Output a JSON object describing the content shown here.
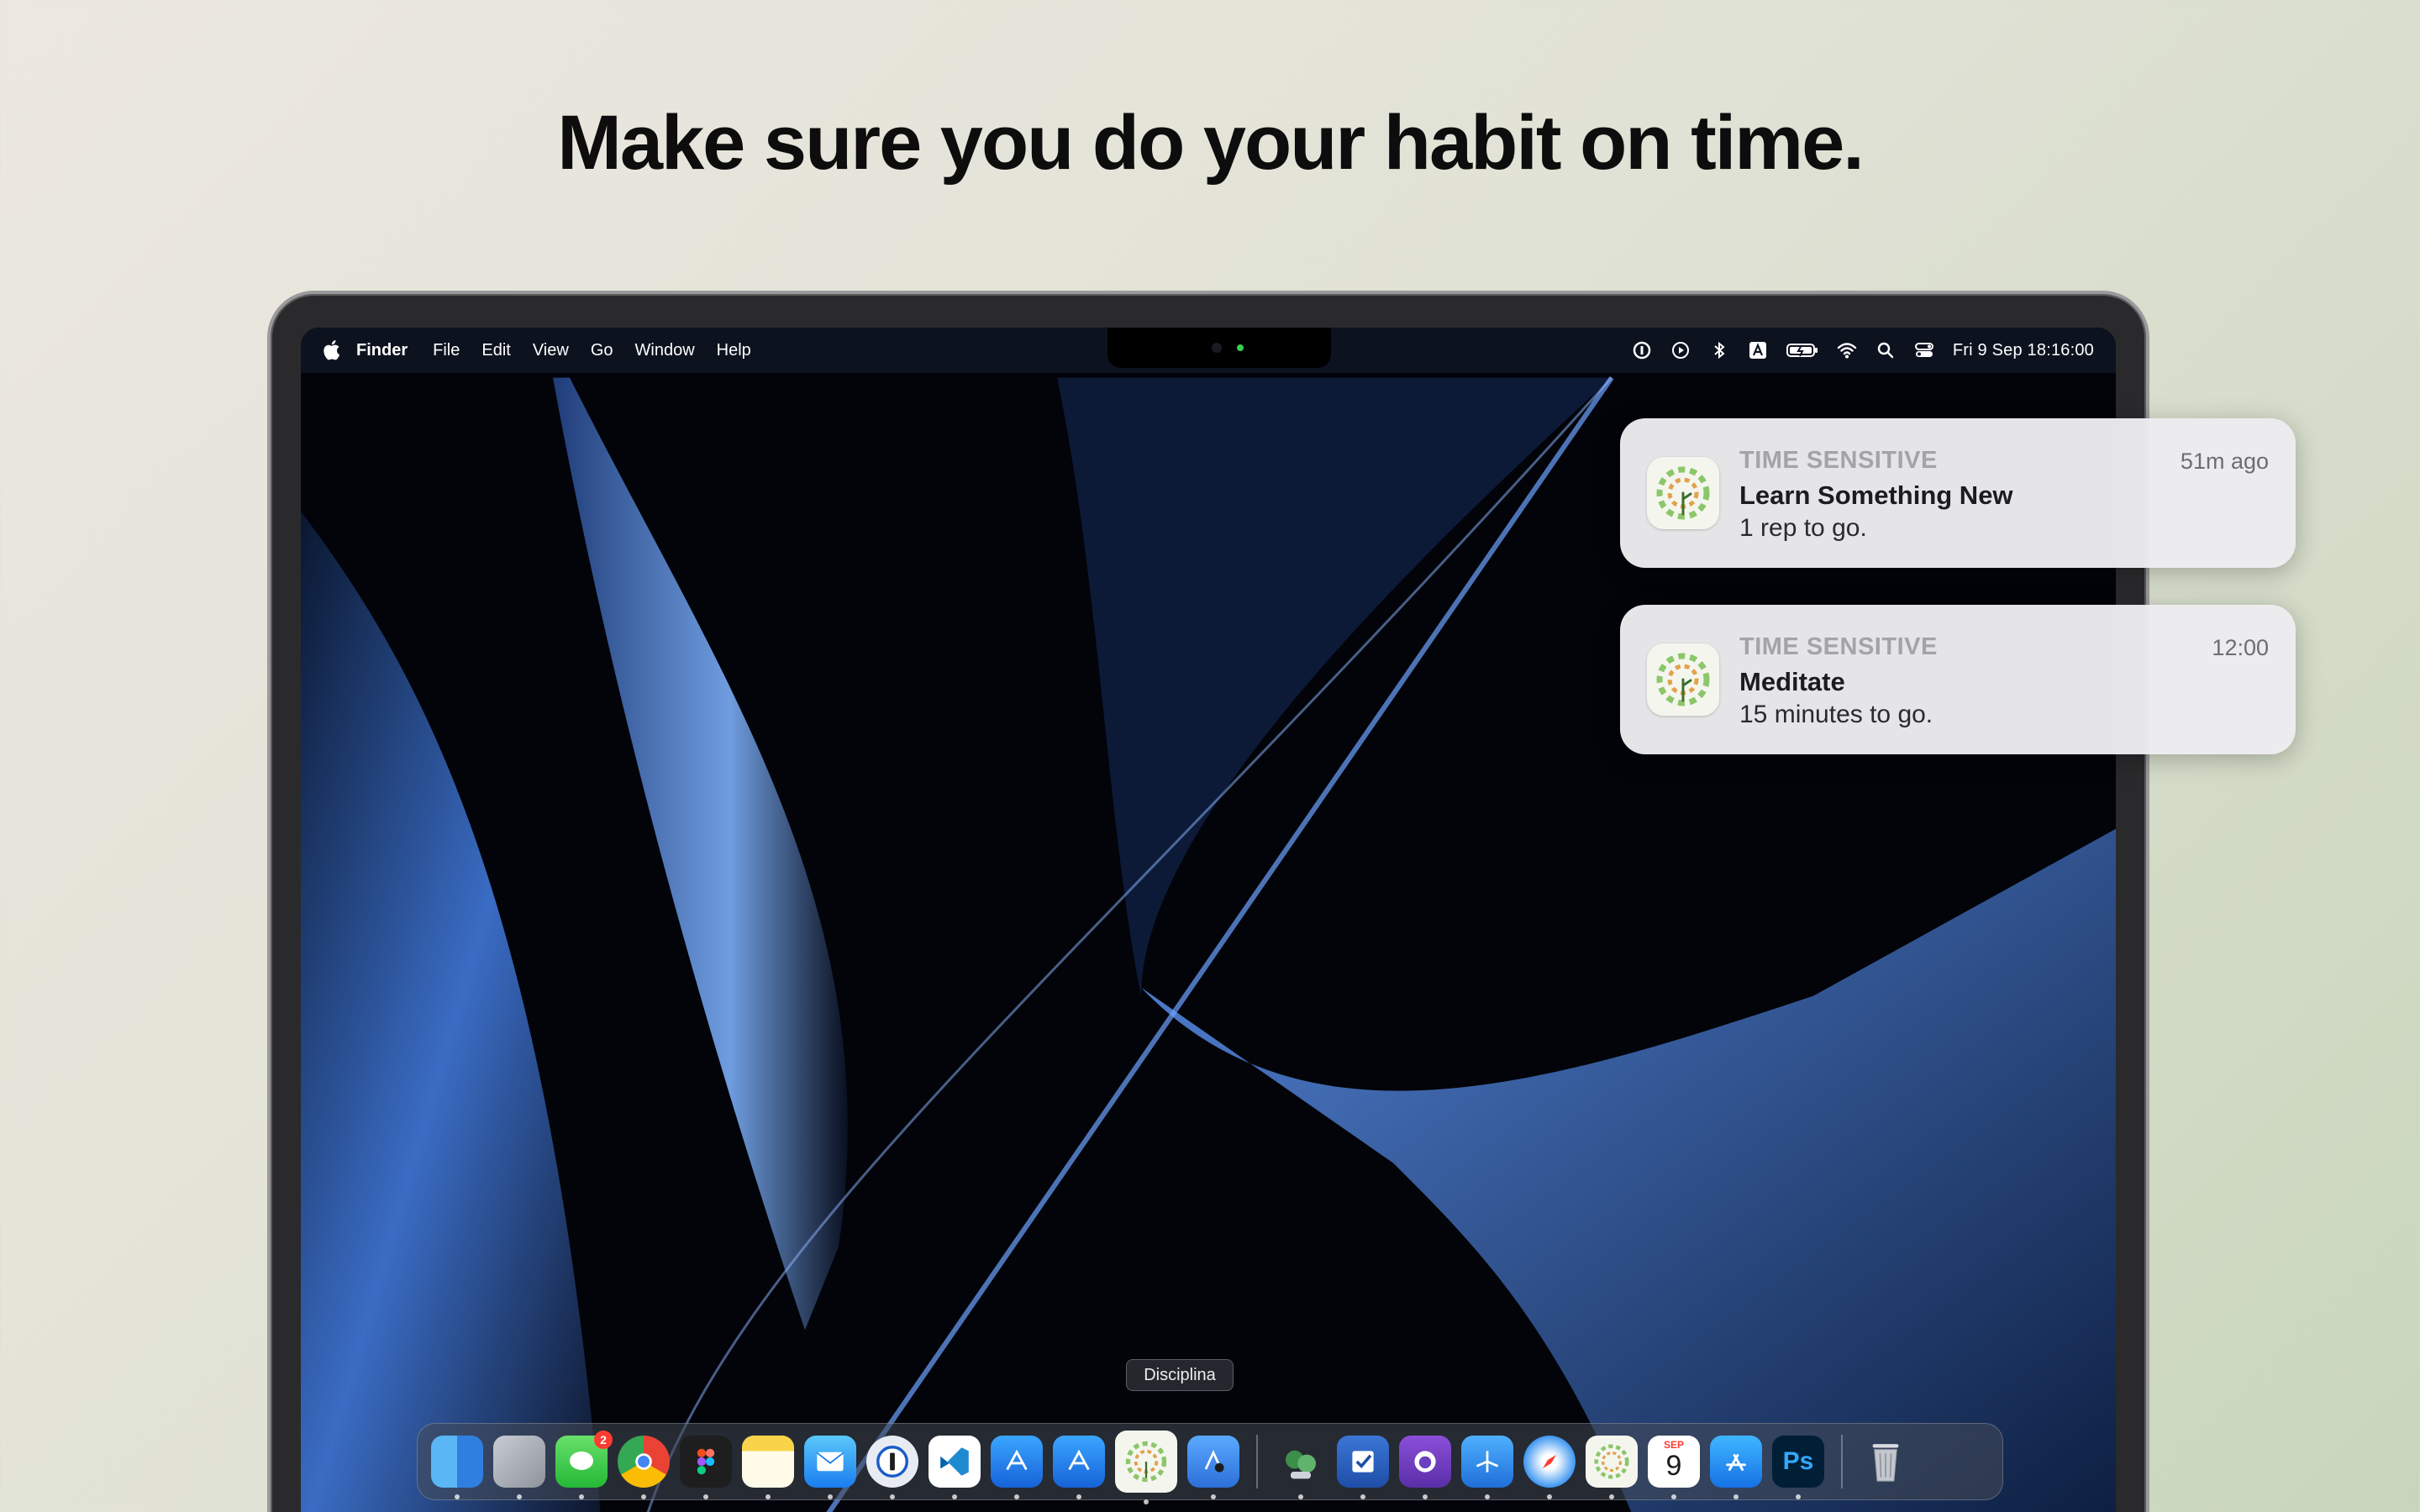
{
  "headline": "Make sure you do your habit on time.",
  "menubar": {
    "app_name": "Finder",
    "menus": [
      "File",
      "Edit",
      "View",
      "Go",
      "Window",
      "Help"
    ],
    "status_icons": [
      "onepassword-icon",
      "play-icon",
      "bluetooth-icon",
      "input-source-icon",
      "battery-icon",
      "wifi-icon",
      "search-icon",
      "control-center-icon"
    ],
    "datetime": "Fri 9 Sep  18:16:00"
  },
  "notifications": [
    {
      "label": "TIME SENSITIVE",
      "time": "51m ago",
      "title": "Learn Something New",
      "body": "1 rep to go."
    },
    {
      "label": "TIME SENSITIVE",
      "time": "12:00",
      "title": "Meditate",
      "body": "15 minutes to go."
    }
  ],
  "dock": {
    "tooltip": "Disciplina",
    "messages_badge": "2",
    "calendar_month": "SEP",
    "calendar_day": "9",
    "photoshop_label": "Ps",
    "apps": [
      "finder",
      "launchpad",
      "messages",
      "chrome",
      "figma",
      "notes",
      "mail",
      "1password",
      "vscode",
      "xcode",
      "xcode-beta",
      "disciplina",
      "instruments",
      "simulator",
      "omnifocus",
      "github-desktop",
      "testflight",
      "safari",
      "disciplina-2",
      "calendar",
      "app-store",
      "photoshop",
      "trash"
    ]
  },
  "colors": {
    "notification_bg": "#ececf0",
    "accent_green": "#6fb24f",
    "badge_red": "#ff3b30"
  }
}
